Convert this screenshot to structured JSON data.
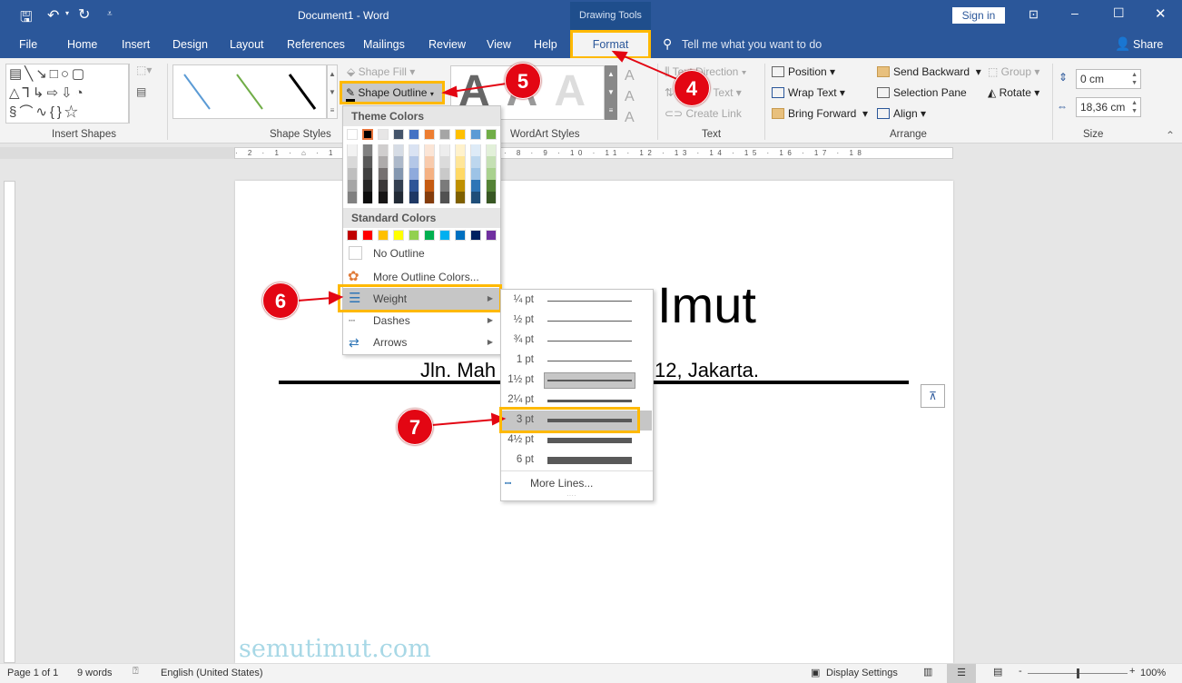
{
  "titlebar": {
    "doc_title": "Document1  -  Word",
    "context_tab": "Drawing Tools",
    "sign_in": "Sign in",
    "qat": {
      "save": "save-icon",
      "undo": "undo-icon",
      "redo": "redo-icon",
      "customize": "customize-qat-icon"
    }
  },
  "tabs": [
    "File",
    "Home",
    "Insert",
    "Design",
    "Layout",
    "References",
    "Mailings",
    "Review",
    "View",
    "Help"
  ],
  "active_tab": "Format",
  "tell_me": "Tell me what you want to do",
  "share": "Share",
  "ribbon": {
    "insert_shapes": "Insert Shapes",
    "shape_styles": "Shape Styles",
    "shape_fill": "Shape Fill",
    "shape_outline": "Shape Outline",
    "wordart_styles": "WordArt Styles",
    "text": {
      "label": "Text",
      "text_direction": "Text Direction",
      "align_text": "Text",
      "create_link": "Create Link"
    },
    "arrange": {
      "label": "Arrange",
      "position": "Position",
      "wrap_text": "Wrap Text",
      "bring_forward": "Bring Forward",
      "send_backward": "Send Backward",
      "selection_pane": "Selection Pane",
      "align": "Align",
      "group": "Group",
      "rotate": "Rotate"
    },
    "size": {
      "label": "Size",
      "height": "0 cm",
      "width": "18,36 cm"
    },
    "style_line_colors": [
      "#5b9bd5",
      "#70ad47",
      "#000000"
    ]
  },
  "ruler_marks": "· 2 · 1 · ⌂ · 1 · 2 · 3 · 4 · 5 · 6 · 7 · 8 · 9 · 10 · 11 · 12 · 13 · 14 · 15 · 16 · 17 · 18",
  "document": {
    "heading_visible": "Imut",
    "address_left": "Jln. Mah",
    "address_right": "12, Jakarta.",
    "watermark": "semutimut.com"
  },
  "outline_menu": {
    "theme_header": "Theme Colors",
    "theme_colors": [
      {
        "base": "#ffffff",
        "shades": [
          "#f2f2f2",
          "#d9d9d9",
          "#bfbfbf",
          "#a6a6a6",
          "#808080"
        ]
      },
      {
        "base": "#000000",
        "shades": [
          "#808080",
          "#595959",
          "#404040",
          "#262626",
          "#0d0d0d"
        ]
      },
      {
        "base": "#e7e6e6",
        "shades": [
          "#d0cece",
          "#aeabab",
          "#767171",
          "#3b3838",
          "#171616"
        ]
      },
      {
        "base": "#44546a",
        "shades": [
          "#d6dce5",
          "#adb9ca",
          "#8497b0",
          "#333f50",
          "#222a35"
        ]
      },
      {
        "base": "#4472c4",
        "shades": [
          "#dae3f3",
          "#b4c7e7",
          "#8faadc",
          "#2f5597",
          "#1f3864"
        ]
      },
      {
        "base": "#ed7d31",
        "shades": [
          "#fbe5d6",
          "#f8cbad",
          "#f4b183",
          "#c55a11",
          "#843c0c"
        ]
      },
      {
        "base": "#a5a5a5",
        "shades": [
          "#ededed",
          "#dbdbdb",
          "#c9c9c9",
          "#7b7b7b",
          "#525252"
        ]
      },
      {
        "base": "#ffc000",
        "shades": [
          "#fff2cc",
          "#ffe699",
          "#ffd966",
          "#bf9000",
          "#7f6000"
        ]
      },
      {
        "base": "#5b9bd5",
        "shades": [
          "#deebf7",
          "#bdd7ee",
          "#9dc3e6",
          "#2e75b6",
          "#1f4e79"
        ]
      },
      {
        "base": "#70ad47",
        "shades": [
          "#e2f0d9",
          "#c5e0b4",
          "#a9d18e",
          "#548235",
          "#385723"
        ]
      }
    ],
    "selected_color": "#000000",
    "standard_header": "Standard Colors",
    "standard_colors": [
      "#c00000",
      "#ff0000",
      "#ffc000",
      "#ffff00",
      "#92d050",
      "#00b050",
      "#00b0f0",
      "#0070c0",
      "#002060",
      "#7030a0"
    ],
    "no_outline": "No Outline",
    "more_colors": "More Outline Colors...",
    "weight": "Weight",
    "dashes": "Dashes",
    "arrows": "Arrows"
  },
  "weight_menu": {
    "items": [
      {
        "label": "¼ pt",
        "pt": 0.25
      },
      {
        "label": "½ pt",
        "pt": 0.5
      },
      {
        "label": "¾ pt",
        "pt": 0.75
      },
      {
        "label": "1 pt",
        "pt": 1
      },
      {
        "label": "1½ pt",
        "pt": 1.5
      },
      {
        "label": "2¼ pt",
        "pt": 2.25
      },
      {
        "label": "3 pt",
        "pt": 3
      },
      {
        "label": "4½ pt",
        "pt": 4.5
      },
      {
        "label": "6 pt",
        "pt": 6
      }
    ],
    "current": "1½ pt",
    "hovered": "3 pt",
    "more_lines": "More Lines..."
  },
  "callouts": [
    "4",
    "5",
    "6",
    "7"
  ],
  "status": {
    "page": "Page 1 of 1",
    "words": "9 words",
    "language": "English (United States)",
    "display_settings": "Display Settings",
    "zoom": "100%",
    "zoom_level": 100
  },
  "accent": "#2b579a",
  "highlight": "#ffb900",
  "callout_color": "#e30613"
}
